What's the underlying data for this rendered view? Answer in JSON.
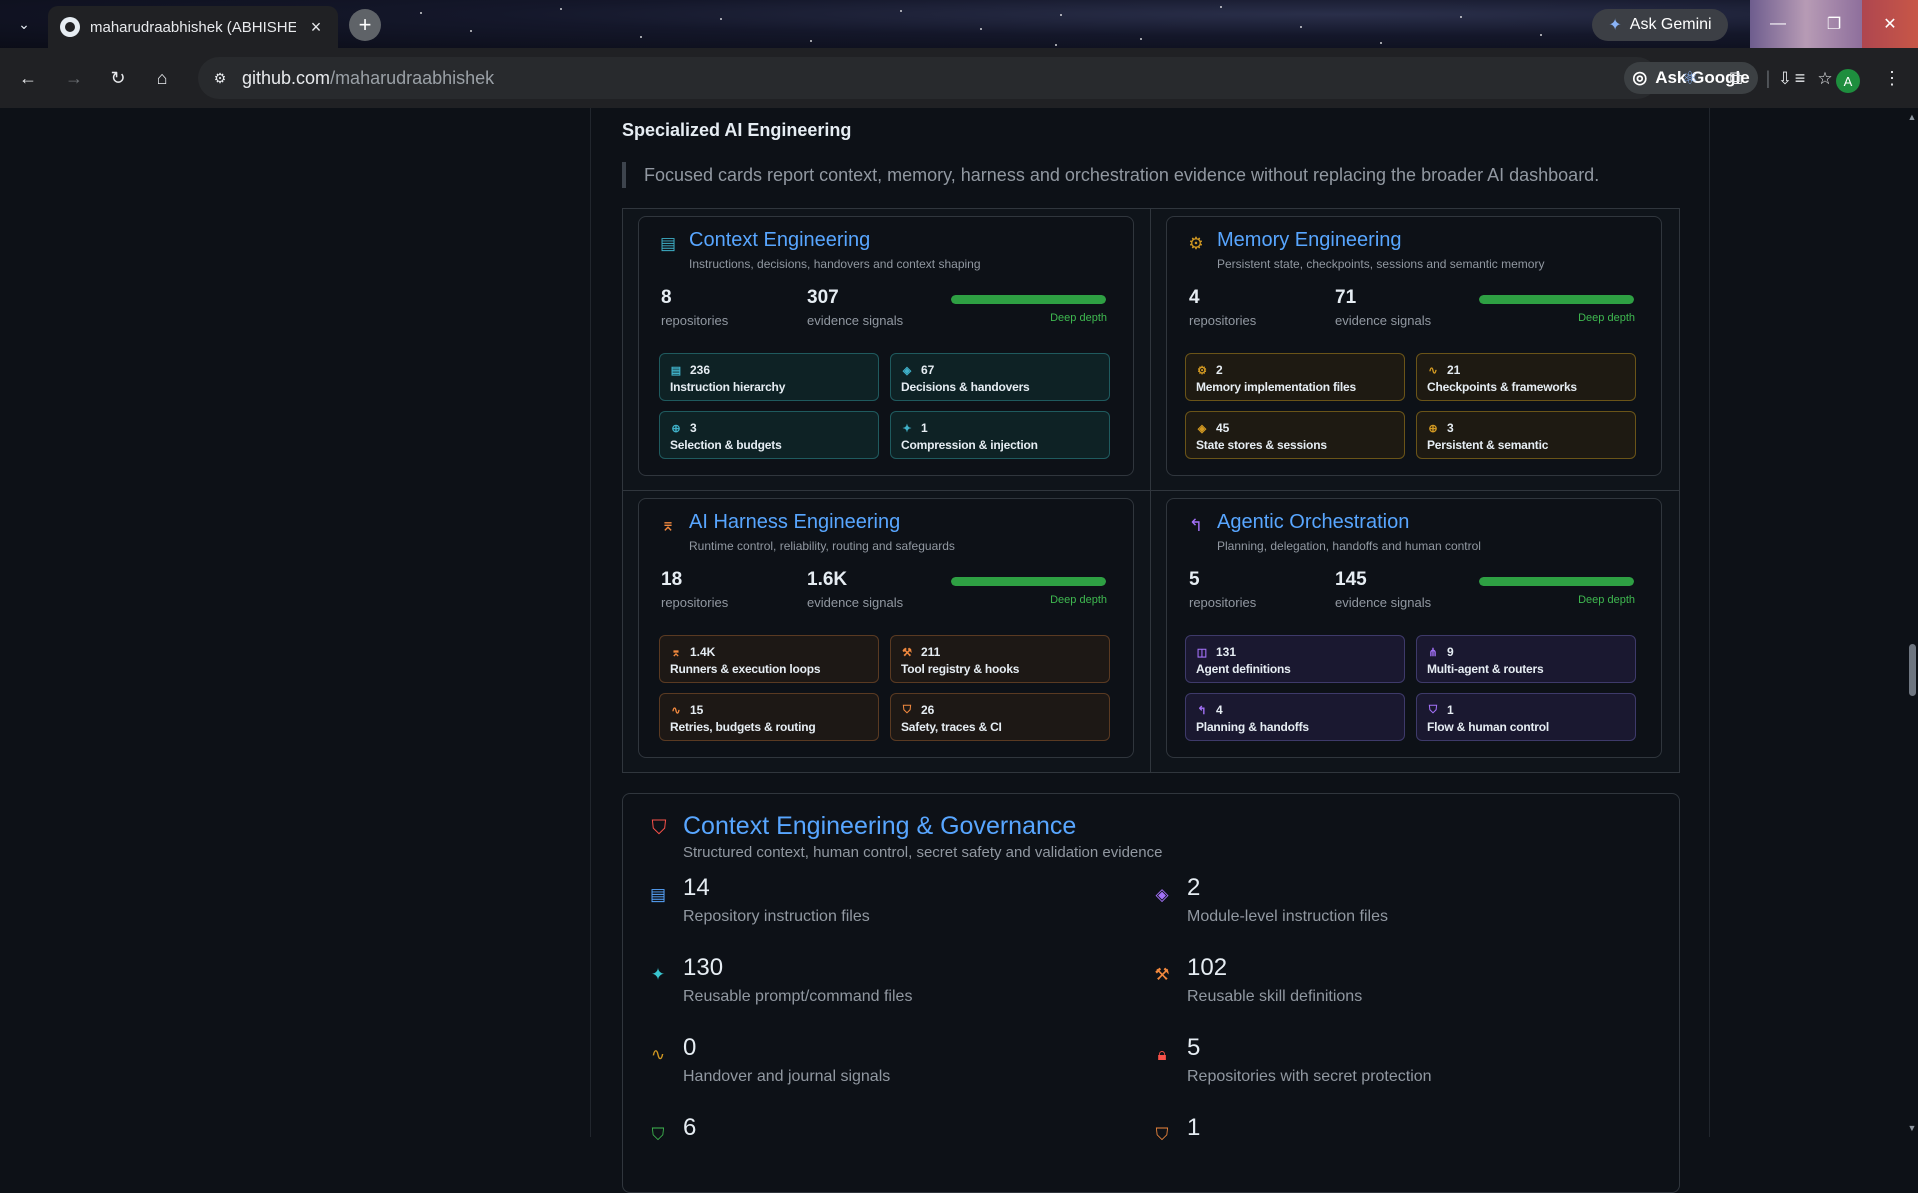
{
  "browser": {
    "tab_title": "maharudraabhishek (ABHISHEK",
    "tab_close": "×",
    "new_tab": "+",
    "ask_gemini": "Ask Gemini",
    "url_host": "github.com",
    "url_path": "/maharudraabhishek",
    "ask_google": "Ask Google",
    "profile_initial": "A"
  },
  "section": {
    "title": "Specialized AI Engineering",
    "description": "Focused cards report context, memory, harness and orchestration evidence without replacing the broader AI dashboard."
  },
  "cards": [
    {
      "title": "Context Engineering",
      "subtitle": "Instructions, decisions, handovers and context shaping",
      "icon": "document-icon",
      "icon_color": "#3fb0c8",
      "repos": "8",
      "repos_label": "repositories",
      "signals": "307",
      "signals_label": "evidence signals",
      "depth": "Deep depth",
      "depth_level": 1.0,
      "tiles": [
        {
          "value": "236",
          "label": "Instruction hierarchy",
          "icon": "document-icon"
        },
        {
          "value": "67",
          "label": "Decisions & handovers",
          "icon": "layers-icon"
        },
        {
          "value": "3",
          "label": "Selection & budgets",
          "icon": "globe-icon"
        },
        {
          "value": "1",
          "label": "Compression & injection",
          "icon": "sparkle-icon"
        }
      ]
    },
    {
      "title": "Memory Engineering",
      "subtitle": "Persistent state, checkpoints, sessions and semantic memory",
      "icon": "chip-icon",
      "icon_color": "#d29922",
      "repos": "4",
      "repos_label": "repositories",
      "signals": "71",
      "signals_label": "evidence signals",
      "depth": "Deep depth",
      "depth_level": 1.0,
      "tiles": [
        {
          "value": "2",
          "label": "Memory implementation files",
          "icon": "chip-icon"
        },
        {
          "value": "21",
          "label": "Checkpoints & frameworks",
          "icon": "pulse-icon"
        },
        {
          "value": "45",
          "label": "State stores & sessions",
          "icon": "layers-icon"
        },
        {
          "value": "3",
          "label": "Persistent & semantic",
          "icon": "globe-icon"
        }
      ]
    },
    {
      "title": "AI Harness Engineering",
      "subtitle": "Runtime control, reliability, routing and safeguards",
      "icon": "harness-icon",
      "icon_color": "#f0883e",
      "repos": "18",
      "repos_label": "repositories",
      "signals": "1.6K",
      "signals_label": "evidence signals",
      "depth": "Deep depth",
      "depth_level": 1.0,
      "tiles": [
        {
          "value": "1.4K",
          "label": "Runners & execution loops",
          "icon": "harness-icon"
        },
        {
          "value": "211",
          "label": "Tool registry & hooks",
          "icon": "wrench-icon"
        },
        {
          "value": "15",
          "label": "Retries, budgets & routing",
          "icon": "pulse-icon"
        },
        {
          "value": "26",
          "label": "Safety, traces & CI",
          "icon": "shield-icon"
        }
      ]
    },
    {
      "title": "Agentic Orchestration",
      "subtitle": "Planning, delegation, handoffs and human control",
      "icon": "route-icon",
      "icon_color": "#a371f7",
      "repos": "5",
      "repos_label": "repositories",
      "signals": "145",
      "signals_label": "evidence signals",
      "depth": "Deep depth",
      "depth_level": 1.0,
      "tiles": [
        {
          "value": "131",
          "label": "Agent definitions",
          "icon": "robot-icon"
        },
        {
          "value": "9",
          "label": "Multi-agent & routers",
          "icon": "network-icon"
        },
        {
          "value": "4",
          "label": "Planning & handoffs",
          "icon": "route-icon"
        },
        {
          "value": "1",
          "label": "Flow & human control",
          "icon": "shield-check-icon"
        }
      ]
    }
  ],
  "governance": {
    "title": "Context Engineering & Governance",
    "subtitle": "Structured context, human control, secret safety and validation evidence",
    "items": [
      {
        "value": "14",
        "label": "Repository instruction files",
        "icon": "document-icon",
        "color": "#58a6ff"
      },
      {
        "value": "2",
        "label": "Module-level instruction files",
        "icon": "layers-icon",
        "color": "#a371f7"
      },
      {
        "value": "130",
        "label": "Reusable prompt/command files",
        "icon": "sparkle-icon",
        "color": "#39c5cf"
      },
      {
        "value": "102",
        "label": "Reusable skill definitions",
        "icon": "wrench-icon",
        "color": "#f0883e"
      },
      {
        "value": "0",
        "label": "Handover and journal signals",
        "icon": "pulse-icon",
        "color": "#d29922"
      },
      {
        "value": "5",
        "label": "Repositories with secret protection",
        "icon": "lock-icon",
        "color": "#f85149"
      },
      {
        "value": "6",
        "label": "",
        "icon": "shield-check-icon",
        "color": "#3fb950"
      },
      {
        "value": "1",
        "label": "",
        "icon": "shield-check-icon",
        "color": "#f0883e"
      }
    ]
  }
}
